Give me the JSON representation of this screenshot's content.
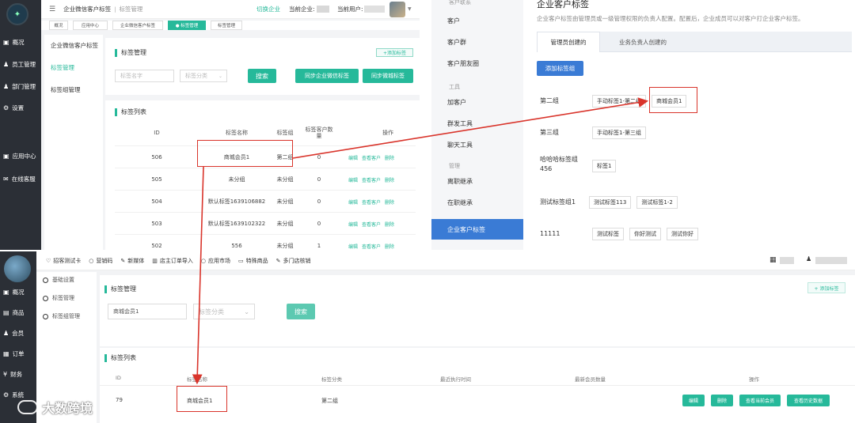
{
  "tl": {
    "header": {
      "breadcrumb_root": "企业微信客户标签",
      "breadcrumb_sep": "|",
      "breadcrumb_current": "标签管理",
      "switch_company": "切换企业",
      "current_company_label": "当前企业:",
      "current_user_label": "当前用户:"
    },
    "nav_tabs": [
      "概况",
      "应用中心",
      "企业微信客户标签",
      "● 标签管理",
      "标签管理"
    ],
    "sidebar": [
      {
        "icon": "▣",
        "label": "概况"
      },
      {
        "icon": "♟",
        "label": "员工管理"
      },
      {
        "icon": "♟",
        "label": "部门管理"
      },
      {
        "icon": "⚙",
        "label": "设置"
      },
      {
        "icon": "▣",
        "label": "应用中心"
      },
      {
        "icon": "✉",
        "label": "在线客服"
      }
    ],
    "subnav": [
      "企业微信客户标签",
      "标签管理",
      "标签组管理"
    ],
    "manage_title": "标签管理",
    "add_tag_btn": "+添加标签",
    "search_placeholder": "标签名字",
    "category_placeholder": "标签分类",
    "search_btn": "搜索",
    "sync_corp_btn": "同步企业微信标签",
    "sync_wx_btn": "同步微城标签",
    "list_title": "标签列表",
    "columns": [
      "ID",
      "标签名称",
      "标签组",
      "标签客户数量",
      "操作"
    ],
    "actions": [
      "编辑",
      "查看客户",
      "删除"
    ],
    "rows": [
      {
        "id": "506",
        "name": "商城会员1",
        "group": "第二组",
        "count": "0"
      },
      {
        "id": "505",
        "name": "未分组",
        "group": "未分组",
        "count": "0"
      },
      {
        "id": "504",
        "name": "默认标签1639106882",
        "group": "未分组",
        "count": "0"
      },
      {
        "id": "503",
        "name": "默认标签1639102322",
        "group": "未分组",
        "count": "0"
      },
      {
        "id": "502",
        "name": "556",
        "group": "未分组",
        "count": "1"
      }
    ]
  },
  "tr": {
    "top_cut": "客户联系",
    "menu": [
      {
        "label": "客户",
        "kind": "item"
      },
      {
        "label": "客户群",
        "kind": "item"
      },
      {
        "label": "客户朋友圈",
        "kind": "item"
      },
      {
        "label": "工具",
        "kind": "section"
      },
      {
        "label": "加客户",
        "kind": "item"
      },
      {
        "label": "群发工具",
        "kind": "item"
      },
      {
        "label": "聊天工具",
        "kind": "item"
      },
      {
        "label": "管理",
        "kind": "section"
      },
      {
        "label": "离职继承",
        "kind": "item"
      },
      {
        "label": "在职继承",
        "kind": "item"
      },
      {
        "label": "企业客户标签",
        "kind": "active"
      }
    ],
    "title": "企业客户标签",
    "desc": "企业客户标签由管理员或一级管理权限的负责人配置。配置后，企业成员可以对客户打企业客户标签。",
    "tab_admin": "管理员创建的",
    "tab_owner": "业务负责人创建的",
    "add_group_btn": "添加标签组",
    "groups": [
      {
        "name": "第二组",
        "tags": [
          "手动标签1-第二组",
          "商城会员1"
        ]
      },
      {
        "name": "第三组",
        "tags": [
          "手动标签1-第三组"
        ]
      },
      {
        "name": "哈哈哈标签组456",
        "tags": [
          "标签1"
        ]
      },
      {
        "name": "测试标签组1",
        "tags": [
          "测试标签113",
          "测试标签1-2"
        ]
      },
      {
        "name": "11111",
        "tags": [
          "测试标签",
          "你好测试",
          "测试你好"
        ]
      }
    ]
  },
  "bt": {
    "topnav": [
      {
        "icon": "♡",
        "label": "招客测试卡"
      },
      {
        "icon": "○",
        "label": "营销码"
      },
      {
        "icon": "✎",
        "label": "新媒体"
      },
      {
        "icon": "▥",
        "label": "店主订单导入"
      },
      {
        "icon": "○",
        "label": "应用市场"
      },
      {
        "icon": "▭",
        "label": "特殊商品"
      },
      {
        "icon": "✎",
        "label": "多门店核销"
      }
    ],
    "sidebar": [
      {
        "icon": "▣",
        "label": "概况"
      },
      {
        "icon": "▤",
        "label": "商品"
      },
      {
        "icon": "♟",
        "label": "会员"
      },
      {
        "icon": "▦",
        "label": "订单"
      },
      {
        "icon": "¥",
        "label": "财务"
      },
      {
        "icon": "⚙",
        "label": "系统"
      }
    ],
    "subnav": [
      "基础设置",
      "标签管理",
      "标签组管理"
    ],
    "manage_title": "标签管理",
    "add_tag_btn": "+ 添加标签",
    "search_value": "商城会员1",
    "category_placeholder": "标签分类",
    "search_btn": "搜索",
    "list_title": "标签列表",
    "columns": [
      "ID",
      "标签名称",
      "标签分类",
      "最近执行时间",
      "最新会员数量",
      "操作"
    ],
    "row": {
      "id": "79",
      "name": "商城会员1",
      "category": "第二组",
      "time": "",
      "count": ""
    },
    "actions": [
      "编辑",
      "删除",
      "查看当前会员",
      "查看历史数据"
    ]
  },
  "watermark": "大数跨境",
  "colors": {
    "accent": "#26b99a",
    "dark_sidebar": "#2b2f36",
    "wecom_blue": "#3a7bd5",
    "highlight": "#d9342b"
  }
}
